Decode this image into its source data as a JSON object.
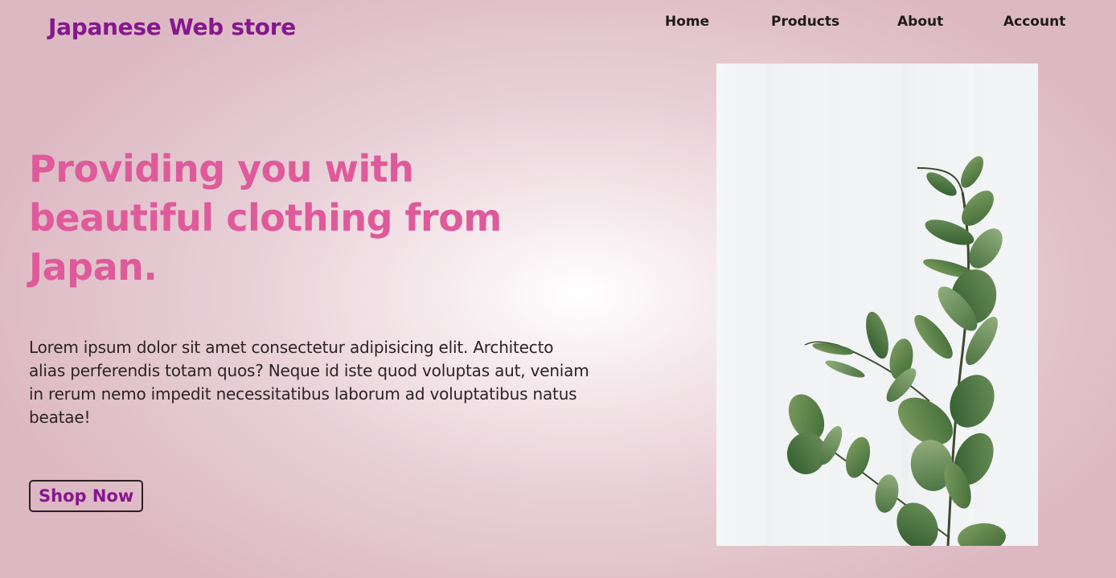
{
  "brand": {
    "name": "Japanese Web store",
    "color": "#86178e"
  },
  "nav": {
    "items": [
      {
        "label": "Home"
      },
      {
        "label": "Products"
      },
      {
        "label": "About"
      },
      {
        "label": "Account"
      }
    ]
  },
  "hero": {
    "headline": "Providing you with beautiful clothing from Japan.",
    "headline_color": "#df5a9a",
    "body": "Lorem ipsum dolor sit amet consectetur adipisicing elit. Architecto alias perferendis totam quos? Neque id iste quod voluptas aut, veniam in rerum nemo impedit necessitatibus laborum ad voluptatibus natus beatae!",
    "cta_label": "Shop Now"
  },
  "image": {
    "icon": "eucalyptus-plant-photo"
  }
}
